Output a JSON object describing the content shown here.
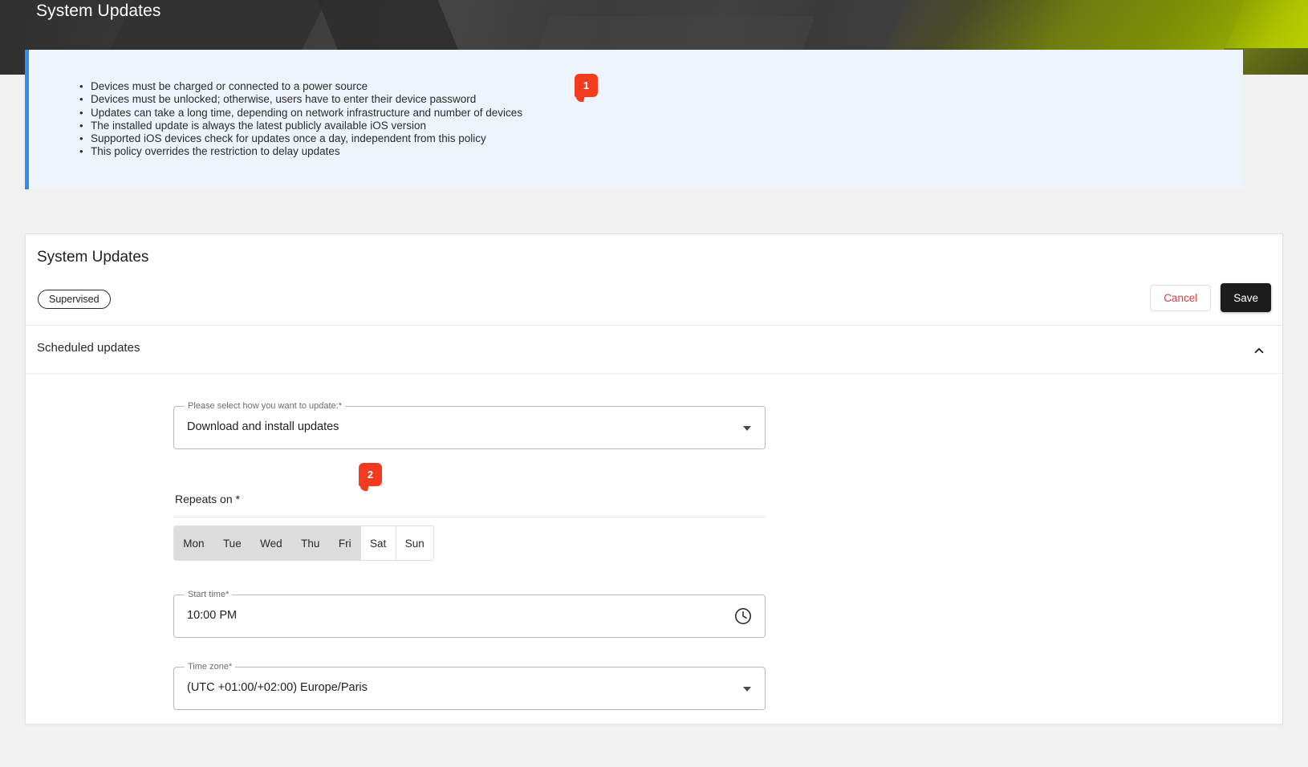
{
  "header": {
    "title": "System Updates",
    "accent_dark": "#3a3a3a",
    "accent_green": "#94ab00"
  },
  "notice": {
    "accent_color": "#2f8ef4",
    "background": "#eef4fc",
    "items": [
      "Devices must be charged or connected to a power source",
      "Devices must be unlocked; otherwise, users have to enter their device password",
      "Updates can take a long time, depending on network infrastructure and number of devices",
      "The installed update is always the latest publicly available iOS version",
      "Supported iOS devices check for updates once a day, independent from this policy",
      "This policy overrides the restriction to delay updates"
    ]
  },
  "callouts": [
    {
      "number": "1",
      "color": "#f43a1f"
    },
    {
      "number": "2",
      "color": "#f43a1f"
    }
  ],
  "card": {
    "title": "System Updates",
    "chip": "Supervised",
    "cancel_label": "Cancel",
    "save_label": "Save",
    "cancel_color": "#e0393e",
    "save_background": "#1b1b1b"
  },
  "section": {
    "title": "Scheduled updates",
    "chevron_icon": "chevron-up-icon",
    "expanded": "true"
  },
  "form": {
    "update_mode": {
      "label": "Please select how you want to update:*",
      "value": "Download and install updates",
      "icon": "chevron-down-icon"
    },
    "repeats_on": {
      "label": "Repeats on *",
      "days": [
        {
          "short": "Mon",
          "selected": true
        },
        {
          "short": "Tue",
          "selected": true
        },
        {
          "short": "Wed",
          "selected": true
        },
        {
          "short": "Thu",
          "selected": true
        },
        {
          "short": "Fri",
          "selected": true
        },
        {
          "short": "Sat",
          "selected": false
        },
        {
          "short": "Sun",
          "selected": false
        }
      ]
    },
    "start_time": {
      "label": "Start time*",
      "value": "10:00 PM",
      "icon": "clock-icon"
    },
    "time_zone": {
      "label": "Time zone*",
      "value": "(UTC +01:00/+02:00) Europe/Paris",
      "icon": "chevron-down-icon"
    }
  }
}
